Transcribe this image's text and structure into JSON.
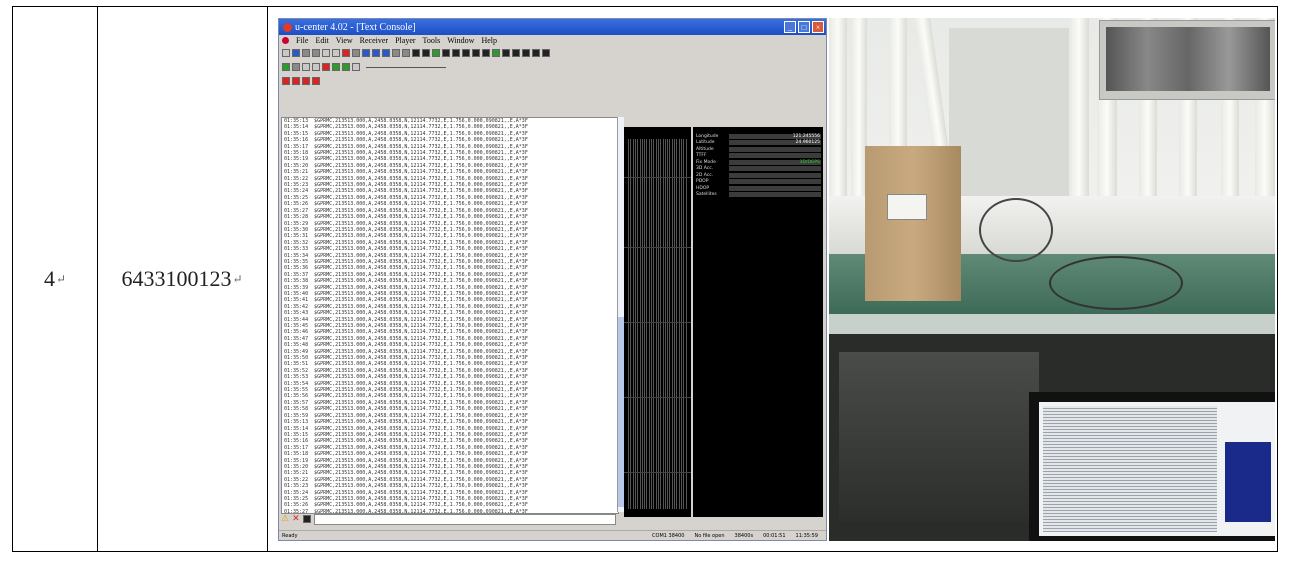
{
  "row": {
    "index": "4",
    "index_mark": "↵",
    "id": "6433100123",
    "id_mark": "↵"
  },
  "ucenter": {
    "title": "u-center 4.02 - [Text Console]",
    "menu": [
      "File",
      "Edit",
      "View",
      "Receiver",
      "Player",
      "Tools",
      "Window",
      "Help"
    ],
    "status": {
      "left": "Ready",
      "port": "COM1 38400",
      "file": "No file open",
      "rate": "38400s",
      "time1": "00:01:51",
      "time2": "11:35:59"
    },
    "nav_panel_labels": [
      "Longitude",
      "Latitude",
      "Altitude",
      "TTFF",
      "Fix Mode",
      "3D Acc.",
      "2D Acc.",
      "PDOP",
      "HDOP",
      "Satellites"
    ],
    "nav_panel_values": [
      "121.245556",
      "24.960125",
      "",
      "",
      "3D/DGPS",
      "",
      "",
      "",
      "",
      ""
    ]
  },
  "icons": {
    "warning": "warning-icon",
    "close": "close-icon"
  }
}
